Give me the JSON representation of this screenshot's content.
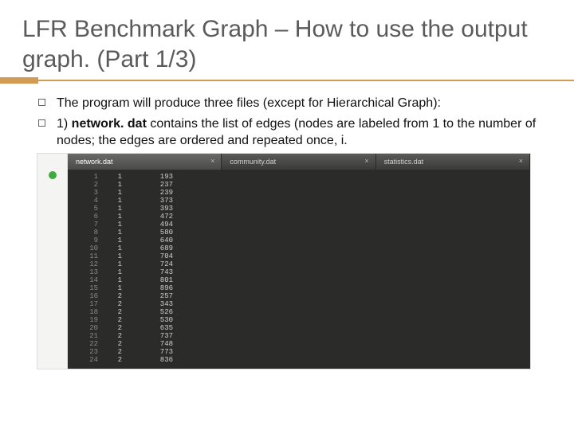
{
  "title": "LFR Benchmark  Graph – How to use the output graph.  (Part  1/3)",
  "bullets": [
    {
      "text": "The program will produce three files  (except  for  Hierarchical Graph):"
    },
    {
      "html": "1) <b>network. dat</b> contains the list of edges (nodes are labeled from 1 to the number of nodes; the edges are ordered and repeated once, i."
    }
  ],
  "editor": {
    "tabs": [
      {
        "label": "network.dat",
        "active": true
      },
      {
        "label": "community.dat",
        "active": false
      },
      {
        "label": "statistics.dat",
        "active": false
      }
    ],
    "rows": [
      {
        "n": 1,
        "a": 1,
        "b": 193
      },
      {
        "n": 2,
        "a": 1,
        "b": 237
      },
      {
        "n": 3,
        "a": 1,
        "b": 239
      },
      {
        "n": 4,
        "a": 1,
        "b": 373
      },
      {
        "n": 5,
        "a": 1,
        "b": 393
      },
      {
        "n": 6,
        "a": 1,
        "b": 472
      },
      {
        "n": 7,
        "a": 1,
        "b": 494
      },
      {
        "n": 8,
        "a": 1,
        "b": 580
      },
      {
        "n": 9,
        "a": 1,
        "b": 640
      },
      {
        "n": 10,
        "a": 1,
        "b": 689
      },
      {
        "n": 11,
        "a": 1,
        "b": 704
      },
      {
        "n": 12,
        "a": 1,
        "b": 724
      },
      {
        "n": 13,
        "a": 1,
        "b": 743
      },
      {
        "n": 14,
        "a": 1,
        "b": 801
      },
      {
        "n": 15,
        "a": 1,
        "b": 896
      },
      {
        "n": 16,
        "a": 2,
        "b": 257
      },
      {
        "n": 17,
        "a": 2,
        "b": 343
      },
      {
        "n": 18,
        "a": 2,
        "b": 526
      },
      {
        "n": 19,
        "a": 2,
        "b": 530
      },
      {
        "n": 20,
        "a": 2,
        "b": 635
      },
      {
        "n": 21,
        "a": 2,
        "b": 737
      },
      {
        "n": 22,
        "a": 2,
        "b": 748
      },
      {
        "n": 23,
        "a": 2,
        "b": 773
      },
      {
        "n": 24,
        "a": 2,
        "b": 836
      }
    ]
  }
}
